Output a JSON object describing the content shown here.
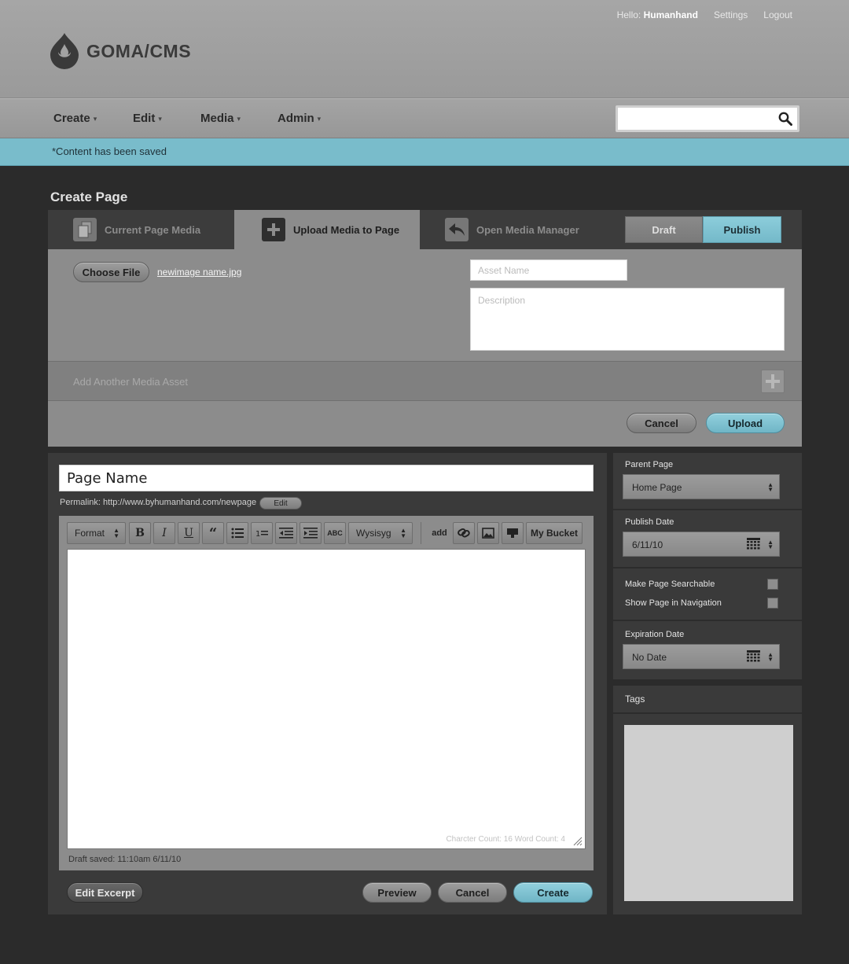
{
  "header": {
    "hello_prefix": "Hello:",
    "username": "Humanhand",
    "settings_label": "Settings",
    "logout_label": "Logout",
    "logo_text": "GOMA/CMS"
  },
  "nav": {
    "items": [
      {
        "label": "Create"
      },
      {
        "label": "Edit"
      },
      {
        "label": "Media"
      },
      {
        "label": "Admin"
      }
    ],
    "search_value": ""
  },
  "flash": {
    "message": "*Content has been saved"
  },
  "page_title": "Create Page",
  "media_panel": {
    "tabs": [
      {
        "label": "Current Page Media",
        "active": false
      },
      {
        "label": "Upload Media to Page",
        "active": true
      },
      {
        "label": "Open Media Manager",
        "active": false
      }
    ],
    "status_toggle": {
      "draft_label": "Draft",
      "publish_label": "Publish",
      "selected": "Publish"
    },
    "choose_file_label": "Choose File",
    "file_name": "newimage name.jpg",
    "asset_name_placeholder": "Asset Name",
    "description_placeholder": "Description",
    "add_asset_label": "Add Another Media Asset",
    "cancel_label": "Cancel",
    "upload_label": "Upload"
  },
  "editor": {
    "page_name": "Page Name",
    "permalink_label": "Permalink: http://www.byhumanhand.com/newpage",
    "permalink_edit_label": "Edit",
    "toolbar": {
      "format_label": "Format",
      "bold": "B",
      "italic": "I",
      "underline": "U",
      "quote": "“",
      "abc": "ABC",
      "mode_label": "Wysisyg",
      "add_label": "add",
      "bucket_label": "My Bucket"
    },
    "body_text": "",
    "counts": "Charcter Count: 16  Word Count: 4",
    "draft_saved": "Draft saved: 11:10am 6/11/10",
    "edit_excerpt_label": "Edit Excerpt",
    "preview_label": "Preview",
    "cancel_label": "Cancel",
    "create_label": "Create"
  },
  "sidebar": {
    "parent_page_label": "Parent Page",
    "parent_page_value": "Home Page",
    "publish_date_label": "Publish Date",
    "publish_date_value": "6/11/10",
    "searchable_label": "Make Page Searchable",
    "searchable_checked": false,
    "show_nav_label": "Show Page in Navigation",
    "show_nav_checked": false,
    "expiration_label": "Expiration Date",
    "expiration_value": "No Date",
    "tags_label": "Tags",
    "tags_value": ""
  },
  "colors": {
    "accent_blue": "#79bccb",
    "header_gray": "#a0a0a0",
    "panel_dark": "#3a3a3a",
    "page_bg": "#2b2b2b"
  }
}
